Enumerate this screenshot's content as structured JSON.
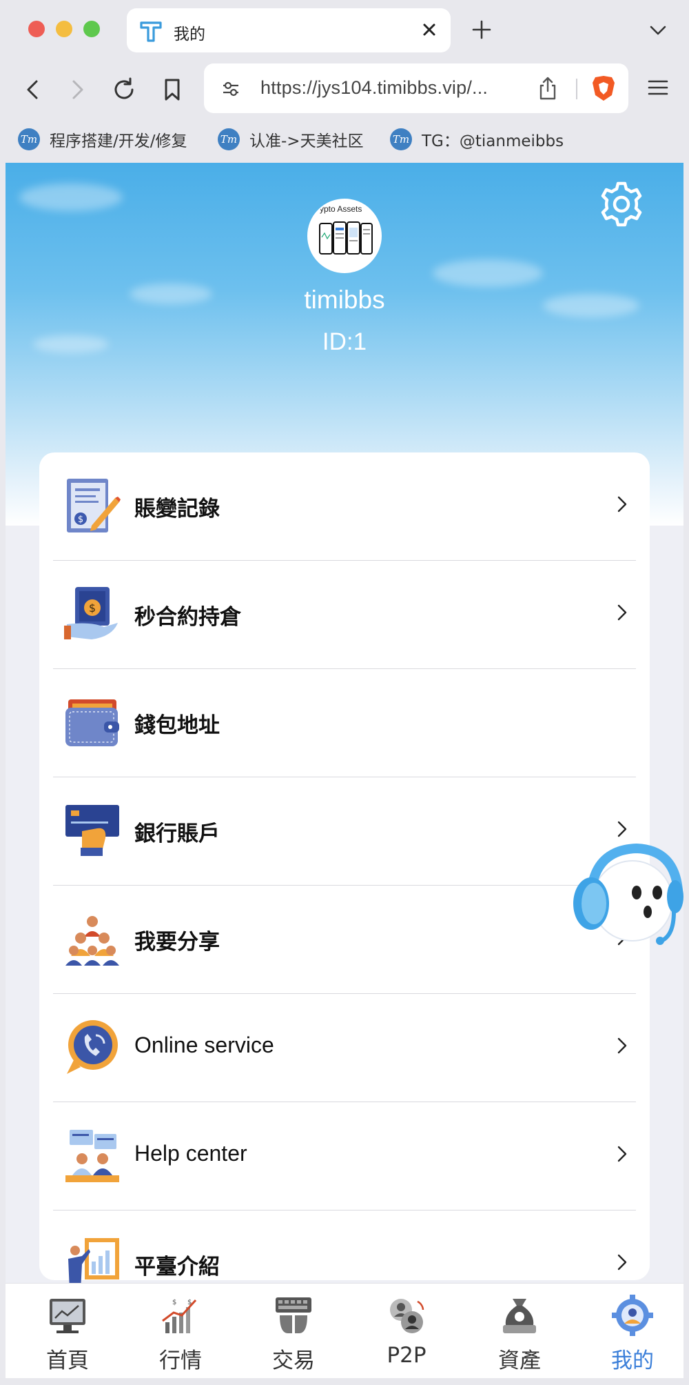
{
  "browser": {
    "tab_title": "我的",
    "url": "https://jys104.timibbs.vip/...",
    "bookmarks": [
      {
        "label": "程序搭建/开发/修复"
      },
      {
        "label": "认准->天美社区"
      },
      {
        "label": "TG：@tianmeibbs"
      }
    ],
    "bookmark_icon_text": "Tm"
  },
  "profile": {
    "avatar_caption": "ypto Assets",
    "username": "timibbs",
    "user_id": "ID:1"
  },
  "menu": {
    "items": [
      {
        "label": "賬變記錄",
        "icon": "ledger-icon"
      },
      {
        "label": "秒合約持倉",
        "icon": "contract-position-icon"
      },
      {
        "label": "錢包地址",
        "icon": "wallet-icon"
      },
      {
        "label": "銀行賬戶",
        "icon": "bank-card-icon"
      },
      {
        "label": "我要分享",
        "icon": "share-people-icon"
      },
      {
        "label": "Online service",
        "icon": "phone-chat-icon"
      },
      {
        "label": "Help center",
        "icon": "help-center-icon"
      },
      {
        "label": "平臺介紹",
        "icon": "presentation-icon"
      }
    ]
  },
  "tabbar": {
    "items": [
      {
        "label": "首頁",
        "icon": "home-monitor-icon"
      },
      {
        "label": "行情",
        "icon": "market-chart-icon"
      },
      {
        "label": "交易",
        "icon": "trade-keyboard-icon"
      },
      {
        "label": "P2P",
        "icon": "p2p-users-icon"
      },
      {
        "label": "資產",
        "icon": "assets-bag-icon"
      },
      {
        "label": "我的",
        "icon": "profile-gear-icon"
      }
    ],
    "active_color": "#3b7fd9"
  },
  "colors": {
    "hero_top": "#4aaee8",
    "accent": "#3b7fd9"
  }
}
